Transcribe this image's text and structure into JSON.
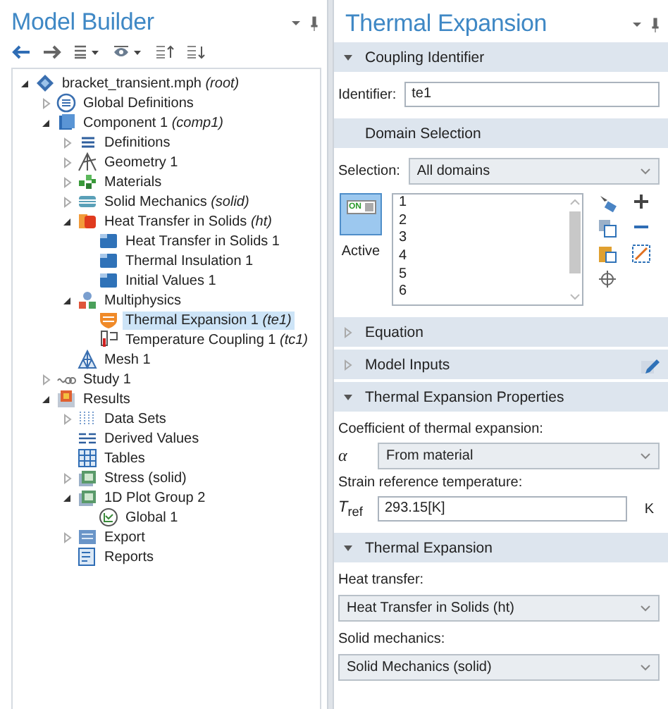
{
  "model_builder": {
    "title": "Model Builder",
    "tree": [
      {
        "label": "bracket_transient.mph *(root)*",
        "kind": "root",
        "expandable": true,
        "expanded": true,
        "selected": false,
        "children": [
          {
            "label": "Global Definitions",
            "kind": "global",
            "expandable": true,
            "expanded": false,
            "selected": false
          },
          {
            "label": "Component 1 *(comp1)*",
            "kind": "component",
            "expandable": true,
            "expanded": true,
            "selected": false,
            "children": [
              {
                "label": "Definitions",
                "kind": "definitions",
                "expandable": true,
                "expanded": false,
                "selected": false
              },
              {
                "label": "Geometry 1",
                "kind": "geometry",
                "expandable": true,
                "expanded": false,
                "selected": false
              },
              {
                "label": "Materials",
                "kind": "materials",
                "expandable": true,
                "expanded": false,
                "selected": false
              },
              {
                "label": "Solid Mechanics *(solid)*",
                "kind": "physics-solid",
                "expandable": true,
                "expanded": false,
                "selected": false
              },
              {
                "label": "Heat Transfer in Solids *(ht)*",
                "kind": "physics-heat",
                "expandable": true,
                "expanded": true,
                "selected": false,
                "children": [
                  {
                    "label": "Heat Transfer in Solids 1",
                    "kind": "node",
                    "expandable": false,
                    "selected": false
                  },
                  {
                    "label": "Thermal Insulation 1",
                    "kind": "node",
                    "expandable": false,
                    "selected": false
                  },
                  {
                    "label": "Initial Values 1",
                    "kind": "node",
                    "expandable": false,
                    "selected": false
                  }
                ]
              },
              {
                "label": "Multiphysics",
                "kind": "multiphysics",
                "expandable": true,
                "expanded": true,
                "selected": false,
                "children": [
                  {
                    "label": "Thermal Expansion 1 *(te1)*",
                    "kind": "coupling-te",
                    "expandable": false,
                    "selected": true
                  },
                  {
                    "label": "Temperature Coupling 1 *(tc1)*",
                    "kind": "coupling-tc",
                    "expandable": false,
                    "selected": false
                  }
                ]
              },
              {
                "label": "Mesh 1",
                "kind": "mesh",
                "expandable": false,
                "selected": false
              }
            ]
          },
          {
            "label": "Study 1",
            "kind": "study",
            "expandable": true,
            "expanded": false,
            "selected": false
          },
          {
            "label": "Results",
            "kind": "results",
            "expandable": true,
            "expanded": true,
            "selected": false,
            "children": [
              {
                "label": "Data Sets",
                "kind": "datasets",
                "expandable": true,
                "expanded": false,
                "selected": false
              },
              {
                "label": "Derived Values",
                "kind": "derived",
                "expandable": false,
                "selected": false
              },
              {
                "label": "Tables",
                "kind": "tables",
                "expandable": false,
                "selected": false
              },
              {
                "label": "Stress (solid)",
                "kind": "plot",
                "expandable": true,
                "expanded": false,
                "selected": false
              },
              {
                "label": "1D Plot Group 2",
                "kind": "plot",
                "expandable": true,
                "expanded": true,
                "selected": false,
                "children": [
                  {
                    "label": "Global 1",
                    "kind": "global-plot",
                    "expandable": false,
                    "selected": false
                  }
                ]
              },
              {
                "label": "Export",
                "kind": "export",
                "expandable": true,
                "expanded": false,
                "selected": false
              },
              {
                "label": "Reports",
                "kind": "reports",
                "expandable": false,
                "selected": false
              }
            ]
          }
        ]
      }
    ]
  },
  "settings": {
    "title": "Thermal Expansion",
    "sections": [
      {
        "title": "Coupling Identifier",
        "collapsible": true,
        "expanded": true,
        "fields": [
          {
            "kind": "text",
            "label": "Identifier:",
            "value": "te1"
          }
        ]
      },
      {
        "title": "Domain Selection",
        "collapsible": false,
        "expanded": true,
        "fields": [
          {
            "kind": "select",
            "label": "Selection:",
            "value": "All domains"
          },
          {
            "kind": "domains",
            "toggle_label": "ON",
            "active_label": "Active",
            "active": true,
            "items": [
              "1",
              "2",
              "3",
              "4",
              "5",
              "6"
            ]
          }
        ]
      },
      {
        "title": "Equation",
        "collapsible": true,
        "expanded": false,
        "edit_button": false
      },
      {
        "title": "Model Inputs",
        "collapsible": true,
        "expanded": false,
        "edit_button": true
      },
      {
        "title": "Thermal Expansion Properties",
        "collapsible": true,
        "expanded": true,
        "fields": [
          {
            "kind": "caption",
            "text": "Coefficient of thermal expansion:"
          },
          {
            "kind": "symbol-select",
            "symbol": "α",
            "value": "From material"
          },
          {
            "kind": "caption",
            "text": "Strain reference temperature:"
          },
          {
            "kind": "symbol-text",
            "symbol": "*T*$_{ref}$",
            "value": "293.15[K]",
            "unit": "K"
          }
        ]
      },
      {
        "title": "Thermal Expansion",
        "collapsible": true,
        "expanded": true,
        "fields": [
          {
            "kind": "caption",
            "text": "Heat transfer:"
          },
          {
            "kind": "wide-select",
            "value": "Heat Transfer in Solids (ht)"
          },
          {
            "kind": "caption",
            "text": "Solid mechanics:"
          },
          {
            "kind": "wide-select",
            "value": "Solid Mechanics (solid)"
          }
        ]
      }
    ]
  }
}
